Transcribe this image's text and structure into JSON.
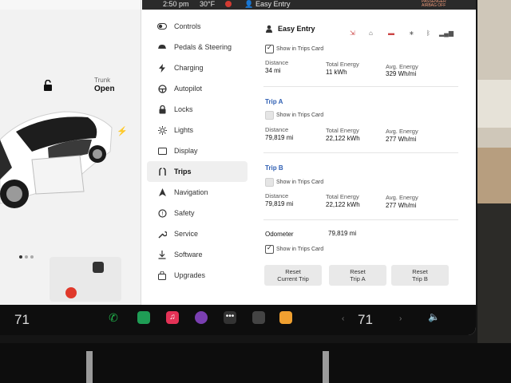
{
  "status_bar": {
    "time": "2:50 pm",
    "temperature": "30°F",
    "profile": "Easy Entry",
    "passenger_airbag": "PASSENGER AIRBAG OFF"
  },
  "car_panel": {
    "trunk_label": "Trunk",
    "trunk_value": "Open",
    "page_dots": 3
  },
  "sidebar": {
    "items": [
      {
        "label": "Controls",
        "icon": "toggle-icon"
      },
      {
        "label": "Pedals & Steering",
        "icon": "car-icon"
      },
      {
        "label": "Charging",
        "icon": "bolt-icon"
      },
      {
        "label": "Autopilot",
        "icon": "steering-wheel-icon"
      },
      {
        "label": "Locks",
        "icon": "lock-icon"
      },
      {
        "label": "Lights",
        "icon": "sun-icon"
      },
      {
        "label": "Display",
        "icon": "display-icon"
      },
      {
        "label": "Trips",
        "icon": "trips-icon",
        "active": true
      },
      {
        "label": "Navigation",
        "icon": "navigation-arrow-icon"
      },
      {
        "label": "Safety",
        "icon": "safety-icon"
      },
      {
        "label": "Service",
        "icon": "wrench-icon"
      },
      {
        "label": "Software",
        "icon": "download-icon"
      },
      {
        "label": "Upgrades",
        "icon": "bag-icon"
      }
    ]
  },
  "trips": {
    "header_title": "Easy Entry",
    "current": {
      "show_label": "Show in Trips Card",
      "show_checked": true,
      "distance_label": "Distance",
      "distance_value": "34 mi",
      "energy_label": "Total Energy",
      "energy_value": "11 kWh",
      "avg_label": "Avg. Energy",
      "avg_value": "329 Wh/mi"
    },
    "trip_a": {
      "title": "Trip A",
      "show_label": "Show in Trips Card",
      "show_checked": false,
      "distance_label": "Distance",
      "distance_value": "79,819 mi",
      "energy_label": "Total Energy",
      "energy_value": "22,122 kWh",
      "avg_label": "Avg. Energy",
      "avg_value": "277 Wh/mi"
    },
    "trip_b": {
      "title": "Trip B",
      "show_label": "Show in Trips Card",
      "show_checked": false,
      "distance_label": "Distance",
      "distance_value": "79,819 mi",
      "energy_label": "Total Energy",
      "energy_value": "22,122 kWh",
      "avg_label": "Avg. Energy",
      "avg_value": "277 Wh/mi"
    },
    "odometer": {
      "label": "Odometer",
      "value": "79,819 mi",
      "show_label": "Show in Trips Card",
      "show_checked": true
    },
    "buttons": {
      "reset_current_1": "Reset",
      "reset_current_2": "Current Trip",
      "reset_a_1": "Reset",
      "reset_a_2": "Trip A",
      "reset_b_1": "Reset",
      "reset_b_2": "Trip B"
    }
  },
  "taskbar": {
    "driver_temp": "71",
    "passenger_temp": "71",
    "apps": [
      "phone-icon",
      "tasks-icon",
      "music-icon",
      "camera-icon",
      "more-dots-icon",
      "video-icon",
      "toybox-icon"
    ],
    "colors": {
      "phone": "#21b24b",
      "tasks": "#1f9d55",
      "music": "#e43256",
      "camera": "#7a3fb1",
      "more": "#333333",
      "video": "#444444",
      "toybox": "#f0a030"
    }
  }
}
